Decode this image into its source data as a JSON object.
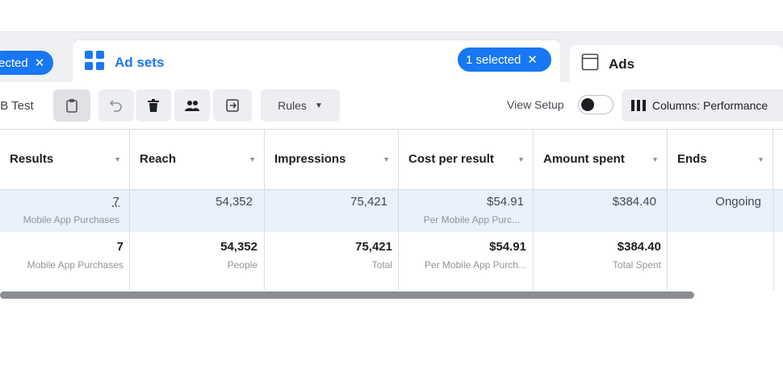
{
  "tabs": {
    "campaigns_selected": "ected",
    "adsets": {
      "title": "Ad sets",
      "selected": "1 selected"
    },
    "ads": {
      "title": "Ads"
    }
  },
  "toolbar": {
    "ab_test": "B Test",
    "rules": "Rules",
    "view_setup": "View Setup",
    "columns": "Columns: Performance"
  },
  "table": {
    "headers": [
      "Results",
      "Reach",
      "Impressions",
      "Cost per result",
      "Amount spent",
      "Ends"
    ],
    "row": {
      "results": "7",
      "results_sub": "Mobile App Purchases",
      "reach": "54,352",
      "impressions": "75,421",
      "cost": "$54.91",
      "cost_sub": "Per Mobile App Purc...",
      "spent": "$384.40",
      "ends": "Ongoing"
    },
    "totals": {
      "results": "7",
      "results_sub": "Mobile App Purchases",
      "reach": "54,352",
      "reach_sub": "People",
      "impressions": "75,421",
      "impressions_sub": "Total",
      "cost": "$54.91",
      "cost_sub": "Per Mobile App Purch...",
      "spent": "$384.40",
      "spent_sub": "Total Spent"
    }
  },
  "colors": {
    "accent": "#1877f2",
    "selected_row": "#e8f1fc"
  }
}
